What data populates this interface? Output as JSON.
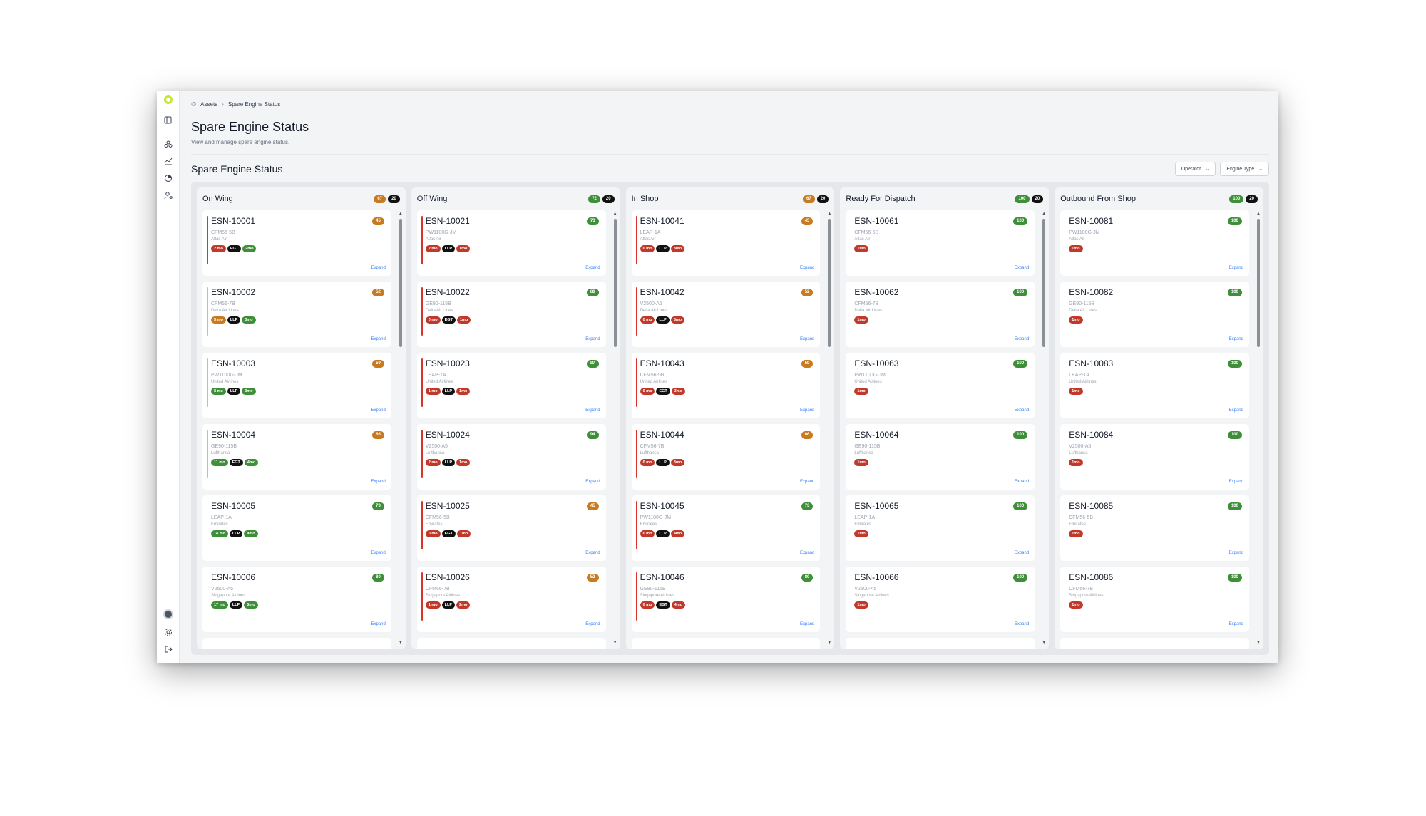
{
  "breadcrumb": {
    "root": "Assets",
    "current": "Spare Engine Status"
  },
  "page": {
    "title": "Spare Engine Status",
    "subtitle": "View and manage spare engine status."
  },
  "section": {
    "title": "Spare Engine Status"
  },
  "filters": {
    "operator": "Operator",
    "engine_type": "Engine Type"
  },
  "expand_label": "Expand",
  "colors": {
    "orange": "#c77a1f",
    "green": "#3f8f3a",
    "black": "#111111",
    "red": "#c0392b",
    "bar_red": "#d9342b",
    "bar_yellow": "#f2c21b",
    "link": "#3b82f6"
  },
  "columns": [
    {
      "title": "On Wing",
      "count_a": "67",
      "count_a_color": "orange",
      "count_b": "20",
      "cards": [
        {
          "esn": "ESN-10001",
          "model": "CFM56-5B",
          "airline": "Atlas Air",
          "score": "45",
          "score_color": "orange",
          "bar": "red",
          "tags": [
            {
              "label": "2 mo",
              "color": "red"
            },
            {
              "label": "EGT",
              "color": "black"
            },
            {
              "label": "2mo",
              "color": "green"
            }
          ]
        },
        {
          "esn": "ESN-10002",
          "model": "CFM56-7B",
          "airline": "Delta Air Lines",
          "score": "52",
          "score_color": "orange",
          "bar": "yellow",
          "tags": [
            {
              "label": "5 mo",
              "color": "orange"
            },
            {
              "label": "LLP",
              "color": "black"
            },
            {
              "label": "3mo",
              "color": "green"
            }
          ]
        },
        {
          "esn": "ESN-10003",
          "model": "PW1100G-JM",
          "airline": "United Airlines",
          "score": "59",
          "score_color": "orange",
          "bar": "yellow",
          "tags": [
            {
              "label": "8 mo",
              "color": "green"
            },
            {
              "label": "LLP",
              "color": "black"
            },
            {
              "label": "3mo",
              "color": "green"
            }
          ]
        },
        {
          "esn": "ESN-10004",
          "model": "GE90-115B",
          "airline": "Lufthansa",
          "score": "66",
          "score_color": "orange",
          "bar": "yellow",
          "tags": [
            {
              "label": "11 mo",
              "color": "green"
            },
            {
              "label": "EGT",
              "color": "black"
            },
            {
              "label": "4mo",
              "color": "green"
            }
          ]
        },
        {
          "esn": "ESN-10005",
          "model": "LEAP-1A",
          "airline": "Emirates",
          "score": "73",
          "score_color": "green",
          "bar": "none",
          "tags": [
            {
              "label": "14 mo",
              "color": "green"
            },
            {
              "label": "LLP",
              "color": "black"
            },
            {
              "label": "4mo",
              "color": "green"
            }
          ]
        },
        {
          "esn": "ESN-10006",
          "model": "V2500-A5",
          "airline": "Singapore Airlines",
          "score": "80",
          "score_color": "green",
          "bar": "none",
          "tags": [
            {
              "label": "17 mo",
              "color": "green"
            },
            {
              "label": "LLP",
              "color": "black"
            },
            {
              "label": "5mo",
              "color": "green"
            }
          ]
        }
      ]
    },
    {
      "title": "Off Wing",
      "count_a": "72",
      "count_a_color": "green",
      "count_b": "20",
      "cards": [
        {
          "esn": "ESN-10021",
          "model": "PW1100G-JM",
          "airline": "Atlas Air",
          "score": "73",
          "score_color": "green",
          "bar": "red",
          "tags": [
            {
              "label": "2 mo",
              "color": "red"
            },
            {
              "label": "LLP",
              "color": "black"
            },
            {
              "label": "1mo",
              "color": "red"
            }
          ]
        },
        {
          "esn": "ESN-10022",
          "model": "GE90-115B",
          "airline": "Delta Air Lines",
          "score": "80",
          "score_color": "green",
          "bar": "red",
          "tags": [
            {
              "label": "0 mo",
              "color": "red"
            },
            {
              "label": "EGT",
              "color": "black"
            },
            {
              "label": "1mo",
              "color": "red"
            }
          ]
        },
        {
          "esn": "ESN-10023",
          "model": "LEAP-1A",
          "airline": "United Airlines",
          "score": "87",
          "score_color": "green",
          "bar": "red",
          "tags": [
            {
              "label": "1 mo",
              "color": "red"
            },
            {
              "label": "LLP",
              "color": "black"
            },
            {
              "label": "1mo",
              "color": "red"
            }
          ]
        },
        {
          "esn": "ESN-10024",
          "model": "V2500-A5",
          "airline": "Lufthansa",
          "score": "94",
          "score_color": "green",
          "bar": "red",
          "tags": [
            {
              "label": "2 mo",
              "color": "red"
            },
            {
              "label": "LLP",
              "color": "black"
            },
            {
              "label": "1mo",
              "color": "red"
            }
          ]
        },
        {
          "esn": "ESN-10025",
          "model": "CFM56-5B",
          "airline": "Emirates",
          "score": "45",
          "score_color": "orange",
          "bar": "red",
          "tags": [
            {
              "label": "0 mo",
              "color": "red"
            },
            {
              "label": "EGT",
              "color": "black"
            },
            {
              "label": "1mo",
              "color": "red"
            }
          ]
        },
        {
          "esn": "ESN-10026",
          "model": "CFM56-7B",
          "airline": "Singapore Airlines",
          "score": "52",
          "score_color": "orange",
          "bar": "red",
          "tags": [
            {
              "label": "1 mo",
              "color": "red"
            },
            {
              "label": "LLP",
              "color": "black"
            },
            {
              "label": "2mo",
              "color": "red"
            }
          ]
        }
      ]
    },
    {
      "title": "In Shop",
      "count_a": "67",
      "count_a_color": "orange",
      "count_b": "20",
      "cards": [
        {
          "esn": "ESN-10041",
          "model": "LEAP-1A",
          "airline": "Atlas Air",
          "score": "45",
          "score_color": "orange",
          "bar": "red",
          "tags": [
            {
              "label": "0 mo",
              "color": "red"
            },
            {
              "label": "LLP",
              "color": "black"
            },
            {
              "label": "3mo",
              "color": "red"
            }
          ]
        },
        {
          "esn": "ESN-10042",
          "model": "V2500-A5",
          "airline": "Delta Air Lines",
          "score": "52",
          "score_color": "orange",
          "bar": "red",
          "tags": [
            {
              "label": "0 mo",
              "color": "red"
            },
            {
              "label": "LLP",
              "color": "black"
            },
            {
              "label": "3mo",
              "color": "red"
            }
          ]
        },
        {
          "esn": "ESN-10043",
          "model": "CFM56-5B",
          "airline": "United Airlines",
          "score": "59",
          "score_color": "orange",
          "bar": "red",
          "tags": [
            {
              "label": "0 mo",
              "color": "red"
            },
            {
              "label": "EGT",
              "color": "black"
            },
            {
              "label": "3mo",
              "color": "red"
            }
          ]
        },
        {
          "esn": "ESN-10044",
          "model": "CFM56-7B",
          "airline": "Lufthansa",
          "score": "66",
          "score_color": "orange",
          "bar": "red",
          "tags": [
            {
              "label": "0 mo",
              "color": "red"
            },
            {
              "label": "LLP",
              "color": "black"
            },
            {
              "label": "3mo",
              "color": "red"
            }
          ]
        },
        {
          "esn": "ESN-10045",
          "model": "PW1100G-JM",
          "airline": "Emirates",
          "score": "73",
          "score_color": "green",
          "bar": "red",
          "tags": [
            {
              "label": "0 mo",
              "color": "red"
            },
            {
              "label": "LLP",
              "color": "black"
            },
            {
              "label": "4mo",
              "color": "red"
            }
          ]
        },
        {
          "esn": "ESN-10046",
          "model": "GE90-115B",
          "airline": "Singapore Airlines",
          "score": "80",
          "score_color": "green",
          "bar": "red",
          "tags": [
            {
              "label": "0 mo",
              "color": "red"
            },
            {
              "label": "EGT",
              "color": "black"
            },
            {
              "label": "4mo",
              "color": "red"
            }
          ]
        }
      ]
    },
    {
      "title": "Ready For Dispatch",
      "count_a": "100",
      "count_a_color": "green",
      "count_b": "20",
      "cards": [
        {
          "esn": "ESN-10061",
          "model": "CFM56-5B",
          "airline": "Atlas Air",
          "score": "100",
          "score_color": "green",
          "bar": "none",
          "tags": [
            {
              "label": "1mo",
              "color": "red"
            }
          ]
        },
        {
          "esn": "ESN-10062",
          "model": "CFM56-7B",
          "airline": "Delta Air Lines",
          "score": "100",
          "score_color": "green",
          "bar": "none",
          "tags": [
            {
              "label": "1mo",
              "color": "red"
            }
          ]
        },
        {
          "esn": "ESN-10063",
          "model": "PW1100G-JM",
          "airline": "United Airlines",
          "score": "100",
          "score_color": "green",
          "bar": "none",
          "tags": [
            {
              "label": "1mo",
              "color": "red"
            }
          ]
        },
        {
          "esn": "ESN-10064",
          "model": "GE90-115B",
          "airline": "Lufthansa",
          "score": "100",
          "score_color": "green",
          "bar": "none",
          "tags": [
            {
              "label": "1mo",
              "color": "red"
            }
          ]
        },
        {
          "esn": "ESN-10065",
          "model": "LEAP-1A",
          "airline": "Emirates",
          "score": "100",
          "score_color": "green",
          "bar": "none",
          "tags": [
            {
              "label": "1mo",
              "color": "red"
            }
          ]
        },
        {
          "esn": "ESN-10066",
          "model": "V2500-A5",
          "airline": "Singapore Airlines",
          "score": "100",
          "score_color": "green",
          "bar": "none",
          "tags": [
            {
              "label": "1mo",
              "color": "red"
            }
          ]
        }
      ]
    },
    {
      "title": "Outbound From Shop",
      "count_a": "100",
      "count_a_color": "green",
      "count_b": "20",
      "cards": [
        {
          "esn": "ESN-10081",
          "model": "PW1100G-JM",
          "airline": "Atlas Air",
          "score": "100",
          "score_color": "green",
          "bar": "none",
          "tags": [
            {
              "label": "1mo",
              "color": "red"
            }
          ]
        },
        {
          "esn": "ESN-10082",
          "model": "GE90-115B",
          "airline": "Delta Air Lines",
          "score": "100",
          "score_color": "green",
          "bar": "none",
          "tags": [
            {
              "label": "1mo",
              "color": "red"
            }
          ]
        },
        {
          "esn": "ESN-10083",
          "model": "LEAP-1A",
          "airline": "United Airlines",
          "score": "100",
          "score_color": "green",
          "bar": "none",
          "tags": [
            {
              "label": "1mo",
              "color": "red"
            }
          ]
        },
        {
          "esn": "ESN-10084",
          "model": "V2500-A5",
          "airline": "Lufthansa",
          "score": "100",
          "score_color": "green",
          "bar": "none",
          "tags": [
            {
              "label": "1mo",
              "color": "red"
            }
          ]
        },
        {
          "esn": "ESN-10085",
          "model": "CFM56-5B",
          "airline": "Emirates",
          "score": "100",
          "score_color": "green",
          "bar": "none",
          "tags": [
            {
              "label": "1mo",
              "color": "red"
            }
          ]
        },
        {
          "esn": "ESN-10086",
          "model": "CFM56-7B",
          "airline": "Singapore Airlines",
          "score": "100",
          "score_color": "green",
          "bar": "none",
          "tags": [
            {
              "label": "1mo",
              "color": "red"
            }
          ]
        }
      ]
    }
  ]
}
